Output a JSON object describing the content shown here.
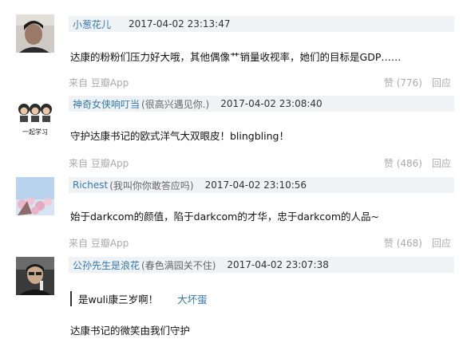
{
  "comments": [
    {
      "username": "小葱花儿",
      "signature": "",
      "timestamp": "2017-04-02 23:13:47",
      "text": "达康的粉粉们压力好大哦，其他偶像艹销量收视率，她们的目标是GDP……",
      "source": "来自 豆瓣App",
      "vote": "赞 (776)",
      "reply": "回应"
    },
    {
      "username": "神奇女侠响叮当",
      "signature": "(很高兴遇见你.)",
      "timestamp": "2017-04-02 23:08:40",
      "avatar_caption": "一起学习",
      "text": "守护达康书记的欧式洋气大双眼皮！blingbling！",
      "source": "来自 豆瓣App",
      "vote": "赞 (486)",
      "reply": "回应"
    },
    {
      "username": "Richest",
      "signature": "(我叫你你敢答应吗)",
      "timestamp": "2017-04-02 23:10:56",
      "text": "始于darkcom的颜值，陷于darkcom的才华，忠于darkcom的人品~",
      "source": "来自 豆瓣App",
      "vote": "赞 (468)",
      "reply": "回应"
    },
    {
      "username": "公孙先生是浪花",
      "signature": "(春色满园关不住)",
      "timestamp": "2017-04-02 23:07:38",
      "quote_text": "是wuli康三岁啊！",
      "quote_author": "大坏蛋",
      "text": "达康书记的微笑由我们守护"
    }
  ]
}
